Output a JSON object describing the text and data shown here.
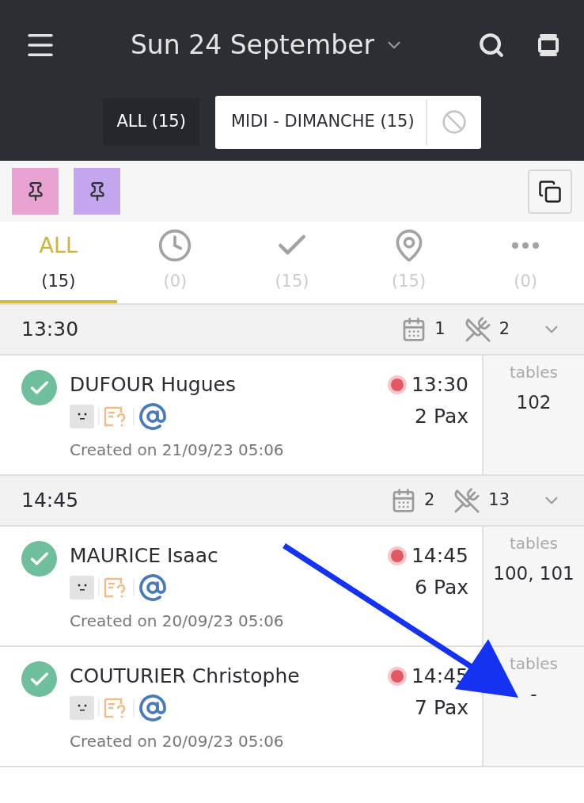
{
  "header": {
    "title": "Sun 24 September"
  },
  "filters": [
    {
      "label": "ALL (15)",
      "selected": false
    },
    {
      "label": "MIDI - DIMANCHE (15)",
      "selected": true
    }
  ],
  "notes": [
    {
      "color": "#e9a3d3"
    },
    {
      "color": "#c3a6ee"
    }
  ],
  "tabs": [
    {
      "kind": "text",
      "label": "ALL",
      "count": "(15)",
      "selected": true
    },
    {
      "kind": "clock",
      "count": "(0)",
      "selected": false
    },
    {
      "kind": "check",
      "count": "(15)",
      "selected": false
    },
    {
      "kind": "pin",
      "count": "(15)",
      "selected": false
    },
    {
      "kind": "more",
      "count": "(0)",
      "selected": false
    }
  ],
  "groups": [
    {
      "time": "13:30",
      "bookings": "1",
      "covers": "2",
      "reservations": [
        {
          "name": "DUFOUR Hugues",
          "time": "13:30",
          "pax": "2 Pax",
          "created": "Created on 21/09/23 05:06",
          "tables_label": "tables",
          "tables": "102",
          "confirmed": true,
          "color": "#e05a66"
        }
      ]
    },
    {
      "time": "14:45",
      "bookings": "2",
      "covers": "13",
      "reservations": [
        {
          "name": "MAURICE Isaac",
          "time": "14:45",
          "pax": "6 Pax",
          "created": "Created on 20/09/23 05:06",
          "tables_label": "tables",
          "tables": "100, 101",
          "confirmed": true,
          "color": "#e05a66"
        },
        {
          "name": "COUTURIER Christophe",
          "time": "14:45",
          "pax": "7 Pax",
          "created": "Created on 20/09/23 05:06",
          "tables_label": "tables",
          "tables": "-",
          "confirmed": true,
          "color": "#e05a66"
        }
      ]
    }
  ]
}
